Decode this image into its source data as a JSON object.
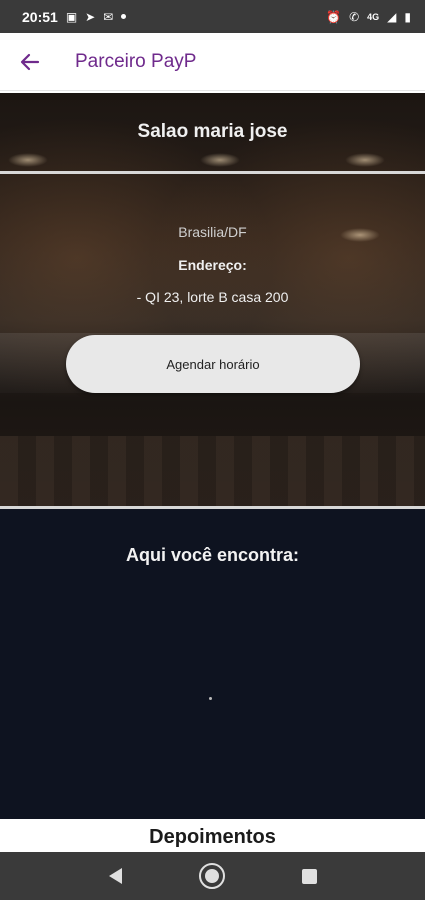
{
  "status_bar": {
    "time": "20:51",
    "network": "4G"
  },
  "app_bar": {
    "title": "Parceiro PayP"
  },
  "salon": {
    "name": "Salao maria jose",
    "city": "Brasilia/DF",
    "address_label": "Endereço:",
    "address_value": "- QI 23, lorte B casa 200",
    "schedule_button": "Agendar horário"
  },
  "section": {
    "title": "Aqui você encontra:"
  },
  "testimonials": {
    "title": "Depoimentos"
  },
  "colors": {
    "accent": "#6f2a8c",
    "dark_section": "#0e1320",
    "button_bg": "#e8e8e8"
  }
}
